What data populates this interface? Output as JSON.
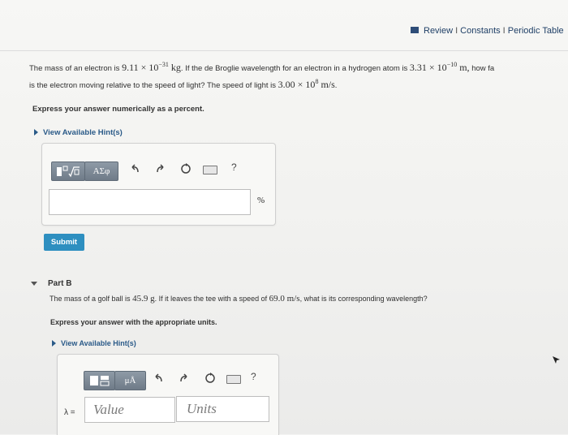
{
  "header": {
    "links": [
      "Review",
      "Constants",
      "Periodic Table"
    ],
    "separator": "I"
  },
  "part_a": {
    "question": {
      "line1_pre": "The mass of an electron is",
      "mass": "9.11 × 10",
      "mass_exp": "−31",
      "mass_unit": "kg",
      "mid": ". If the de Broglie wavelength for an electron in a hydrogen atom is",
      "wl": "3.31 × 10",
      "wl_exp": "−10",
      "wl_unit": "m,",
      "line1_end": "how fa",
      "line2_pre": "is the electron moving relative to the speed of light? The speed of light is",
      "c": "3.00 × 10",
      "c_exp": "8",
      "c_unit": "m/s",
      "line2_end": "."
    },
    "instruction": "Express your answer numerically as a percent.",
    "hint_label": "View Available Hint(s)",
    "toolbar": {
      "greek": "ΑΣφ",
      "help": "?"
    },
    "answer_value": "",
    "unit_label": "%",
    "submit_label": "Submit"
  },
  "part_b": {
    "title": "Part B",
    "question": {
      "pre": "The mass of a golf ball is",
      "mass": "45.9",
      "mass_unit": "g",
      "mid": ". If it leaves the tee with a speed of",
      "speed": "69.0",
      "speed_unit": "m/s",
      "post": ", what is its corresponding wavelength?"
    },
    "instruction": "Express your answer with the appropriate units.",
    "hint_label": "View Available Hint(s)",
    "toolbar": {
      "units": "μÅ",
      "help": "?"
    },
    "lambda_label": "λ =",
    "value_placeholder": "Value",
    "units_placeholder": "Units"
  },
  "colors": {
    "accent": "#2e8fc0",
    "link": "#1f3f66",
    "toolbar": "#7a8693"
  }
}
